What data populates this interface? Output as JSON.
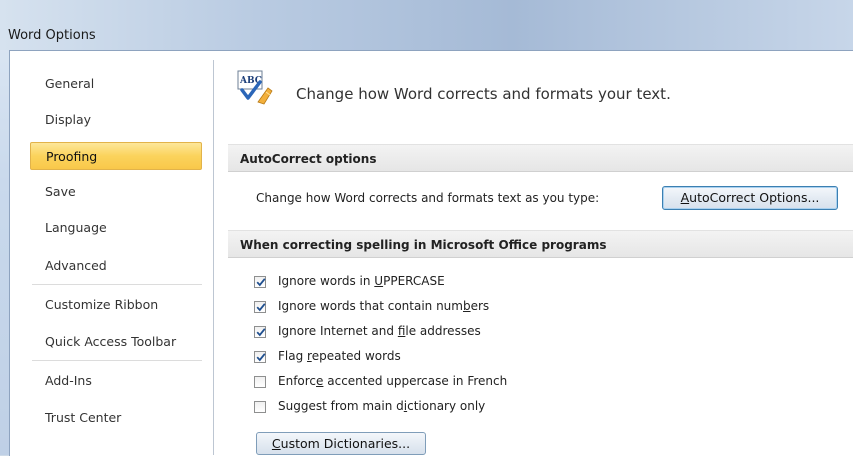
{
  "window": {
    "title": "Word Options"
  },
  "nav": {
    "items": [
      {
        "label": "General",
        "selected": false
      },
      {
        "label": "Display",
        "selected": false
      },
      {
        "label": "Proofing",
        "selected": true
      },
      {
        "label": "Save",
        "selected": false
      },
      {
        "label": "Language",
        "selected": false
      },
      {
        "label": "Advanced",
        "selected": false
      },
      {
        "label": "Customize Ribbon",
        "selected": false
      },
      {
        "label": "Quick Access Toolbar",
        "selected": false
      },
      {
        "label": "Add-Ins",
        "selected": false
      },
      {
        "label": "Trust Center",
        "selected": false
      }
    ]
  },
  "header": {
    "icon": "abc-spellcheck-icon",
    "text": "Change how Word corrects and formats your text."
  },
  "autocorrect": {
    "section_title": "AutoCorrect options",
    "description": "Change how Word corrects and formats text as you type:",
    "button_prefix": "",
    "button_mnemonic": "A",
    "button_suffix": "utoCorrect Options..."
  },
  "spelling": {
    "section_title": "When correcting spelling in Microsoft Office programs",
    "options": [
      {
        "pre": "Ignore words in ",
        "mn": "U",
        "post": "PPERCASE",
        "checked": true
      },
      {
        "pre": "Ignore words that contain num",
        "mn": "b",
        "post": "ers",
        "checked": true
      },
      {
        "pre": "Ignore Internet and ",
        "mn": "f",
        "post": "ile addresses",
        "checked": true
      },
      {
        "pre": "Flag ",
        "mn": "r",
        "post": "epeated words",
        "checked": true
      },
      {
        "pre": "Enforc",
        "mn": "e",
        "post": " accented uppercase in French",
        "checked": false
      },
      {
        "pre": "Suggest from main d",
        "mn": "i",
        "post": "ctionary only",
        "checked": false
      }
    ],
    "custom_dict_prefix": "",
    "custom_dict_mnemonic": "C",
    "custom_dict_suffix": "ustom Dictionaries..."
  },
  "colors": {
    "selected_nav": "#fbd35c",
    "check": "#1f4f8f"
  }
}
